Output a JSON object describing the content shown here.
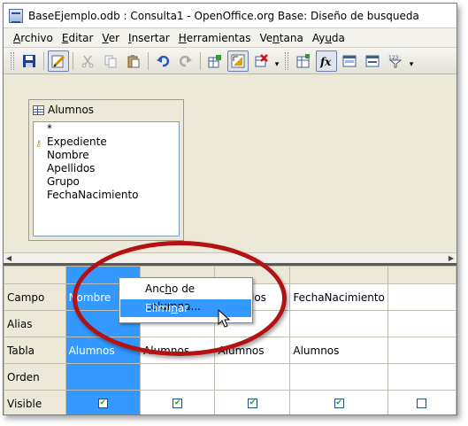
{
  "window": {
    "title": "BaseEjemplo.odb : Consulta1 - OpenOffice.org Base: Diseño de busqueda"
  },
  "menu": [
    {
      "pre": "",
      "u": "A",
      "post": "rchivo"
    },
    {
      "pre": "",
      "u": "E",
      "post": "ditar"
    },
    {
      "pre": "",
      "u": "V",
      "post": "er"
    },
    {
      "pre": "",
      "u": "I",
      "post": "nsertar"
    },
    {
      "pre": "",
      "u": "H",
      "post": "erramientas"
    },
    {
      "pre": "Ve",
      "u": "n",
      "post": "tana"
    },
    {
      "pre": "Ay",
      "u": "u",
      "post": "da"
    }
  ],
  "toolbar": {
    "icons": [
      "save-icon",
      "edit-icon",
      "cut-icon",
      "copy-icon",
      "paste-icon",
      "undo-icon",
      "redo-icon",
      "add-table-icon",
      "design-view-icon",
      "clear-query-icon",
      "functions-icon",
      "table-name-icon",
      "alias-icon",
      "distinct-icon",
      "filter-icon"
    ]
  },
  "table_box": {
    "title": "Alumnos",
    "fields": [
      "*",
      "Expediente",
      "Nombre",
      "Apellidos",
      "Grupo",
      "FechaNacimiento"
    ],
    "key_field": "Expediente"
  },
  "grid": {
    "row_labels": [
      "Campo",
      "Alias",
      "Tabla",
      "Orden",
      "Visible"
    ],
    "columns": [
      {
        "campo": "Nombre",
        "alias": "",
        "tabla": "Alumnos",
        "orden": "",
        "visible": true,
        "selected": true
      },
      {
        "campo": "",
        "alias": "",
        "tabla": "Alumnos",
        "orden": "",
        "visible": true,
        "selected": false
      },
      {
        "campo": "Apellidos",
        "alias": "",
        "tabla": "Alumnos",
        "orden": "",
        "visible": true,
        "selected": false
      },
      {
        "campo": "FechaNacimiento",
        "alias": "",
        "tabla": "Alumnos",
        "orden": "",
        "visible": true,
        "selected": false
      },
      {
        "campo": "",
        "alias": "",
        "tabla": "",
        "orden": "",
        "visible": false,
        "selected": false
      }
    ]
  },
  "context_menu": {
    "items": [
      {
        "pre": "Anc",
        "u": "h",
        "post": "o de columna..."
      },
      {
        "pre": "Elimi",
        "u": "n",
        "post": "ar"
      }
    ],
    "highlighted_index": 1
  },
  "colors": {
    "selection": "#3399ff",
    "annotation": "#b31212"
  }
}
